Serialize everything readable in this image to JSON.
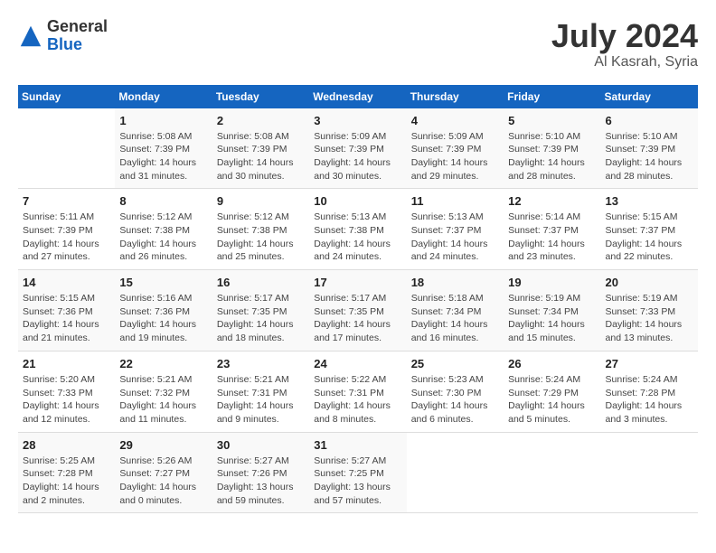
{
  "logo": {
    "general": "General",
    "blue": "Blue"
  },
  "title": {
    "month_year": "July 2024",
    "location": "Al Kasrah, Syria"
  },
  "days_of_week": [
    "Sunday",
    "Monday",
    "Tuesday",
    "Wednesday",
    "Thursday",
    "Friday",
    "Saturday"
  ],
  "weeks": [
    [
      {
        "day": "",
        "info": ""
      },
      {
        "day": "1",
        "info": "Sunrise: 5:08 AM\nSunset: 7:39 PM\nDaylight: 14 hours\nand 31 minutes."
      },
      {
        "day": "2",
        "info": "Sunrise: 5:08 AM\nSunset: 7:39 PM\nDaylight: 14 hours\nand 30 minutes."
      },
      {
        "day": "3",
        "info": "Sunrise: 5:09 AM\nSunset: 7:39 PM\nDaylight: 14 hours\nand 30 minutes."
      },
      {
        "day": "4",
        "info": "Sunrise: 5:09 AM\nSunset: 7:39 PM\nDaylight: 14 hours\nand 29 minutes."
      },
      {
        "day": "5",
        "info": "Sunrise: 5:10 AM\nSunset: 7:39 PM\nDaylight: 14 hours\nand 28 minutes."
      },
      {
        "day": "6",
        "info": "Sunrise: 5:10 AM\nSunset: 7:39 PM\nDaylight: 14 hours\nand 28 minutes."
      }
    ],
    [
      {
        "day": "7",
        "info": "Sunrise: 5:11 AM\nSunset: 7:39 PM\nDaylight: 14 hours\nand 27 minutes."
      },
      {
        "day": "8",
        "info": "Sunrise: 5:12 AM\nSunset: 7:38 PM\nDaylight: 14 hours\nand 26 minutes."
      },
      {
        "day": "9",
        "info": "Sunrise: 5:12 AM\nSunset: 7:38 PM\nDaylight: 14 hours\nand 25 minutes."
      },
      {
        "day": "10",
        "info": "Sunrise: 5:13 AM\nSunset: 7:38 PM\nDaylight: 14 hours\nand 24 minutes."
      },
      {
        "day": "11",
        "info": "Sunrise: 5:13 AM\nSunset: 7:37 PM\nDaylight: 14 hours\nand 24 minutes."
      },
      {
        "day": "12",
        "info": "Sunrise: 5:14 AM\nSunset: 7:37 PM\nDaylight: 14 hours\nand 23 minutes."
      },
      {
        "day": "13",
        "info": "Sunrise: 5:15 AM\nSunset: 7:37 PM\nDaylight: 14 hours\nand 22 minutes."
      }
    ],
    [
      {
        "day": "14",
        "info": "Sunrise: 5:15 AM\nSunset: 7:36 PM\nDaylight: 14 hours\nand 21 minutes."
      },
      {
        "day": "15",
        "info": "Sunrise: 5:16 AM\nSunset: 7:36 PM\nDaylight: 14 hours\nand 19 minutes."
      },
      {
        "day": "16",
        "info": "Sunrise: 5:17 AM\nSunset: 7:35 PM\nDaylight: 14 hours\nand 18 minutes."
      },
      {
        "day": "17",
        "info": "Sunrise: 5:17 AM\nSunset: 7:35 PM\nDaylight: 14 hours\nand 17 minutes."
      },
      {
        "day": "18",
        "info": "Sunrise: 5:18 AM\nSunset: 7:34 PM\nDaylight: 14 hours\nand 16 minutes."
      },
      {
        "day": "19",
        "info": "Sunrise: 5:19 AM\nSunset: 7:34 PM\nDaylight: 14 hours\nand 15 minutes."
      },
      {
        "day": "20",
        "info": "Sunrise: 5:19 AM\nSunset: 7:33 PM\nDaylight: 14 hours\nand 13 minutes."
      }
    ],
    [
      {
        "day": "21",
        "info": "Sunrise: 5:20 AM\nSunset: 7:33 PM\nDaylight: 14 hours\nand 12 minutes."
      },
      {
        "day": "22",
        "info": "Sunrise: 5:21 AM\nSunset: 7:32 PM\nDaylight: 14 hours\nand 11 minutes."
      },
      {
        "day": "23",
        "info": "Sunrise: 5:21 AM\nSunset: 7:31 PM\nDaylight: 14 hours\nand 9 minutes."
      },
      {
        "day": "24",
        "info": "Sunrise: 5:22 AM\nSunset: 7:31 PM\nDaylight: 14 hours\nand 8 minutes."
      },
      {
        "day": "25",
        "info": "Sunrise: 5:23 AM\nSunset: 7:30 PM\nDaylight: 14 hours\nand 6 minutes."
      },
      {
        "day": "26",
        "info": "Sunrise: 5:24 AM\nSunset: 7:29 PM\nDaylight: 14 hours\nand 5 minutes."
      },
      {
        "day": "27",
        "info": "Sunrise: 5:24 AM\nSunset: 7:28 PM\nDaylight: 14 hours\nand 3 minutes."
      }
    ],
    [
      {
        "day": "28",
        "info": "Sunrise: 5:25 AM\nSunset: 7:28 PM\nDaylight: 14 hours\nand 2 minutes."
      },
      {
        "day": "29",
        "info": "Sunrise: 5:26 AM\nSunset: 7:27 PM\nDaylight: 14 hours\nand 0 minutes."
      },
      {
        "day": "30",
        "info": "Sunrise: 5:27 AM\nSunset: 7:26 PM\nDaylight: 13 hours\nand 59 minutes."
      },
      {
        "day": "31",
        "info": "Sunrise: 5:27 AM\nSunset: 7:25 PM\nDaylight: 13 hours\nand 57 minutes."
      },
      {
        "day": "",
        "info": ""
      },
      {
        "day": "",
        "info": ""
      },
      {
        "day": "",
        "info": ""
      }
    ]
  ]
}
